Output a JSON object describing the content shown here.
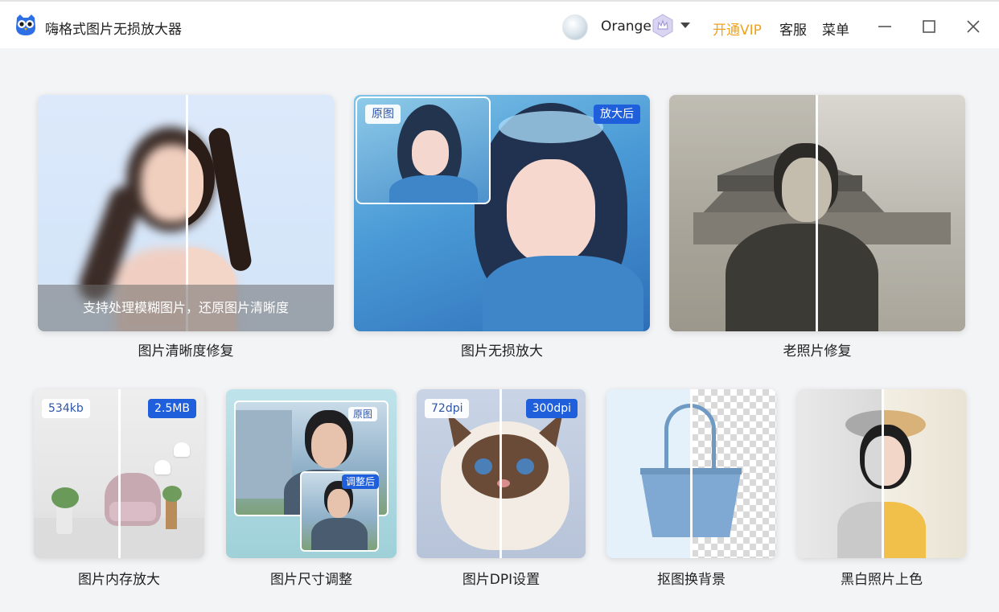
{
  "window": {
    "app_title": "嗨格式图片无损放大器",
    "user_name": "Orange",
    "vip_label": "开通VIP",
    "service_label": "客服",
    "menu_label": "菜单"
  },
  "colors": {
    "accent_blue": "#1f5fdc",
    "vip_orange": "#f0a21b",
    "background": "#f3f4f6"
  },
  "icons": {
    "logo": "owl-logo-icon",
    "avatar": "user-avatar",
    "vip": "vip-crown-badge-icon",
    "dropdown": "caret-down-icon",
    "minimize": "minimize-icon",
    "maximize": "maximize-icon",
    "close": "close-icon"
  },
  "features_top": [
    {
      "title": "图片清晰度修复",
      "overlay": "支持处理模糊图片，还原图片清晰度"
    },
    {
      "title": "图片无损放大",
      "badge_before": "原图",
      "badge_after": "放大后"
    },
    {
      "title": "老照片修复"
    }
  ],
  "features_bottom": [
    {
      "title": "图片内存放大",
      "badge_before": "534kb",
      "badge_after": "2.5MB"
    },
    {
      "title": "图片尺寸调整",
      "badge_before": "原图",
      "badge_after": "调整后"
    },
    {
      "title": "图片DPI设置",
      "badge_before": "72dpi",
      "badge_after": "300dpi"
    },
    {
      "title": "抠图换背景"
    },
    {
      "title": "黑白照片上色"
    }
  ]
}
